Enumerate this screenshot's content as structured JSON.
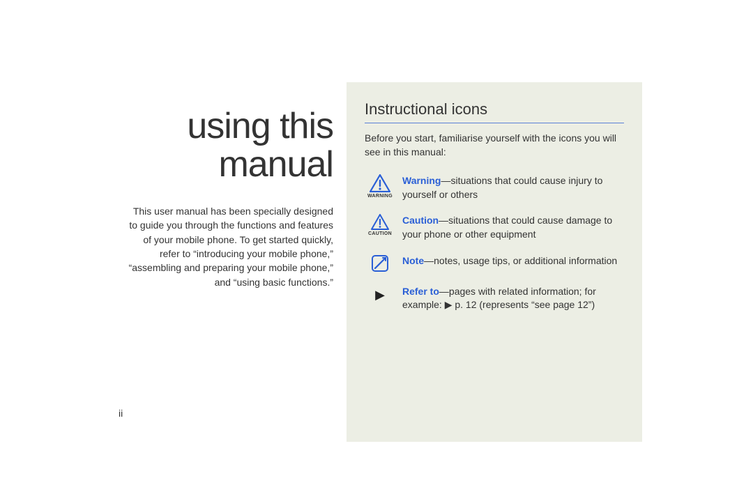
{
  "left": {
    "title_line1": "using this",
    "title_line2": "manual",
    "body": "This user manual has been specially designed to guide you through the functions and features of your mobile phone. To get started quickly, refer to “introducing your mobile phone,” “assembling and preparing your mobile phone,” and “using basic functions.”"
  },
  "page_number": "ii",
  "right": {
    "heading": "Instructional icons",
    "intro": "Before you start, familiarise yourself with the icons you will see in this manual:",
    "items": [
      {
        "icon_name": "warning-icon",
        "caption": "WARNING",
        "term": "Warning",
        "desc": "—situations that could cause injury to yourself or others"
      },
      {
        "icon_name": "caution-icon",
        "caption": "CAUTION",
        "term": "Caution",
        "desc": "—situations that could cause damage to your phone or other equipment"
      },
      {
        "icon_name": "note-icon",
        "caption": "",
        "term": "Note",
        "desc": "—notes, usage tips, or additional information"
      },
      {
        "icon_name": "refer-to-icon",
        "caption": "",
        "term": "Refer to",
        "desc": "—pages with related information; for example: ▶ p. 12 (represents “see page 12”)"
      }
    ]
  }
}
